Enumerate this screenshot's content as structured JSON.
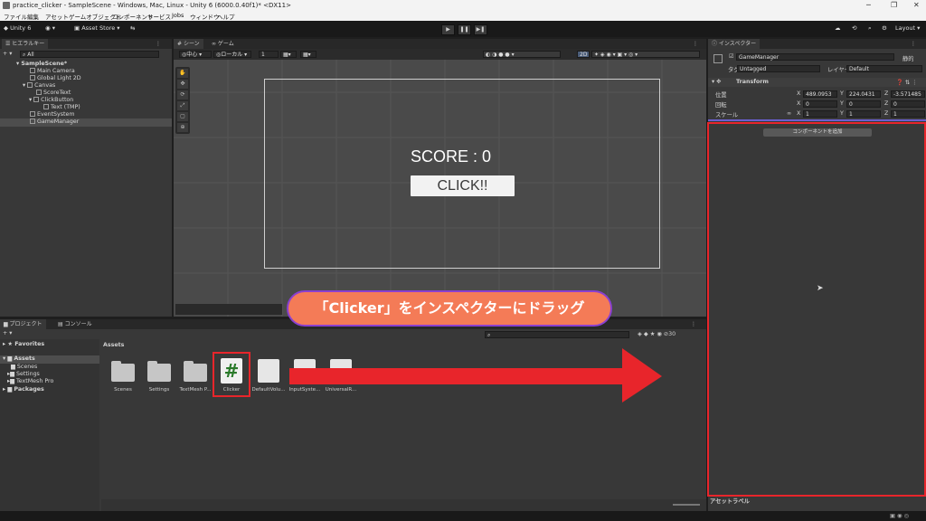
{
  "window": {
    "title": "practice_clicker - SampleScene - Windows, Mac, Linux - Unity 6 (6000.0.40f1)* <DX11>"
  },
  "menu": [
    "ファイル",
    "編集",
    "アセット",
    "ゲームオブジェクト",
    "コンポーネント",
    "サービス",
    "Jobs",
    "ウィンドウ",
    "ヘルプ"
  ],
  "toolbar": {
    "unity_label": "Unity 6",
    "asset_store": "Asset Store",
    "layout": "Layout"
  },
  "hierarchy": {
    "tab": "ヒエラルキー",
    "search_placeholder": "All",
    "items": [
      "SampleScene*",
      "Main Camera",
      "Global Light 2D",
      "Canvas",
      "ScoreText",
      "ClickButton",
      "Text (TMP)",
      "EventSystem",
      "GameManager"
    ]
  },
  "scene": {
    "tabs": [
      "シーン",
      "ゲーム"
    ],
    "pivot": "中心",
    "space": "ローカル",
    "view_mode": "2D",
    "grid_value": "1",
    "score_text": "SCORE : 0",
    "click_text": "CLICK!!"
  },
  "inspector": {
    "tab": "インスペクター",
    "object_name": "GameManager",
    "static_label": "静的",
    "tag_label": "タグ",
    "tag_value": "Untagged",
    "layer_label": "レイヤー",
    "layer_value": "Default",
    "component": "Transform",
    "rows": [
      {
        "label": "位置",
        "x": "489.0953",
        "y": "224.0431",
        "z": "-3.571485"
      },
      {
        "label": "回転",
        "x": "0",
        "y": "0",
        "z": "0"
      },
      {
        "label": "スケール",
        "x": "1",
        "y": "1",
        "z": "1"
      }
    ],
    "add_component": "コンポーネントを追加",
    "asset_labels": "アセットラベル"
  },
  "project": {
    "tabs": [
      "プロジェクト",
      "コンソール"
    ],
    "tree": [
      "Favorites",
      "Assets",
      "Scenes",
      "Settings",
      "TextMesh Pro",
      "Packages"
    ],
    "breadcrumb": "Assets",
    "count": "30",
    "assets": [
      "Scenes",
      "Settings",
      "TextMesh P...",
      "Clicker",
      "DefaultVolu...",
      "InputSyste...",
      "UniversalR..."
    ]
  },
  "callout": {
    "text": "「Clicker」をインスペクターにドラッグ"
  },
  "colors": {
    "highlight_red": "#e8252b",
    "callout_bg": "#f47b57",
    "callout_border": "#8a3fd0",
    "arrow_red": "#e8252b"
  }
}
